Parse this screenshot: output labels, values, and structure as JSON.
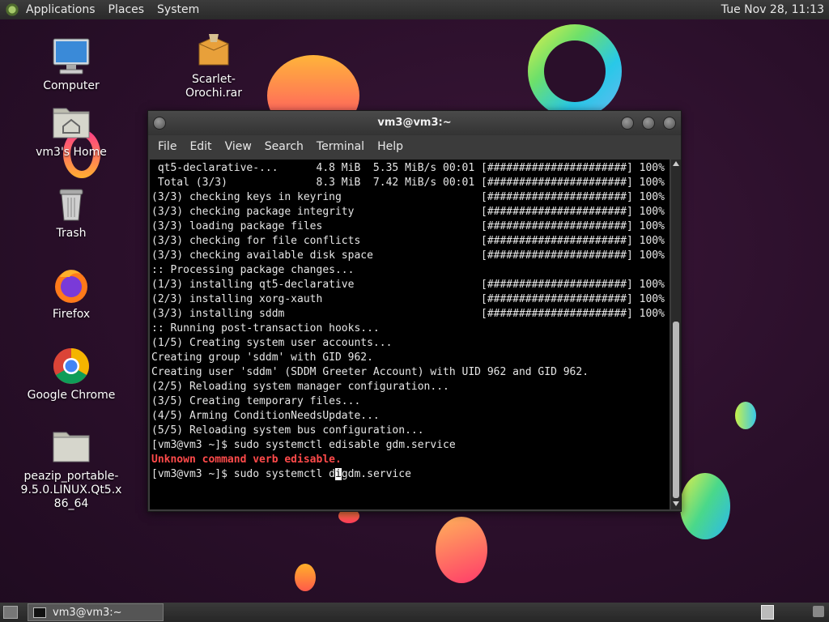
{
  "top_panel": {
    "menus": [
      "Applications",
      "Places",
      "System"
    ],
    "clock": "Tue Nov 28, 11:13"
  },
  "desktop": {
    "icons": [
      {
        "label": "Computer",
        "icon": "computer-icon"
      },
      {
        "label": "vm3's Home",
        "icon": "home-folder-icon"
      },
      {
        "label": "Trash",
        "icon": "trash-icon"
      },
      {
        "label": "Firefox",
        "icon": "firefox-icon"
      },
      {
        "label": "Google Chrome",
        "icon": "chrome-icon"
      },
      {
        "label": "peazip_portable-9.5.0.LINUX.Qt5.x86_64",
        "icon": "folder-icon"
      },
      {
        "label": "Scarlet-Orochi.rar",
        "icon": "archive-icon"
      }
    ]
  },
  "terminal": {
    "title": "vm3@vm3:~",
    "menu": [
      "File",
      "Edit",
      "View",
      "Search",
      "Terminal",
      "Help"
    ],
    "lines": [
      " qt5-declarative-...      4.8 MiB  5.35 MiB/s 00:01 [######################] 100%",
      " Total (3/3)              8.3 MiB  7.42 MiB/s 00:01 [######################] 100%",
      "(3/3) checking keys in keyring                      [######################] 100%",
      "(3/3) checking package integrity                    [######################] 100%",
      "(3/3) loading package files                         [######################] 100%",
      "(3/3) checking for file conflicts                   [######################] 100%",
      "(3/3) checking available disk space                 [######################] 100%",
      ":: Processing package changes...",
      "(1/3) installing qt5-declarative                    [######################] 100%",
      "(2/3) installing xorg-xauth                         [######################] 100%",
      "(3/3) installing sddm                               [######################] 100%",
      ":: Running post-transaction hooks...",
      "(1/5) Creating system user accounts...",
      "Creating group 'sddm' with GID 962.",
      "Creating user 'sddm' (SDDM Greeter Account) with UID 962 and GID 962.",
      "(2/5) Reloading system manager configuration...",
      "(3/5) Creating temporary files...",
      "(4/5) Arming ConditionNeedsUpdate...",
      "(5/5) Reloading system bus configuration...",
      "[vm3@vm3 ~]$ sudo systemctl edisable gdm.service"
    ],
    "error_line": "Unknown command verb edisable.",
    "prompt_before_cursor": "[vm3@vm3 ~]$ sudo systemctl d",
    "cursor_char": "i",
    "prompt_after_cursor": "gdm.service"
  },
  "taskbar": {
    "task_label": "vm3@vm3:~"
  }
}
